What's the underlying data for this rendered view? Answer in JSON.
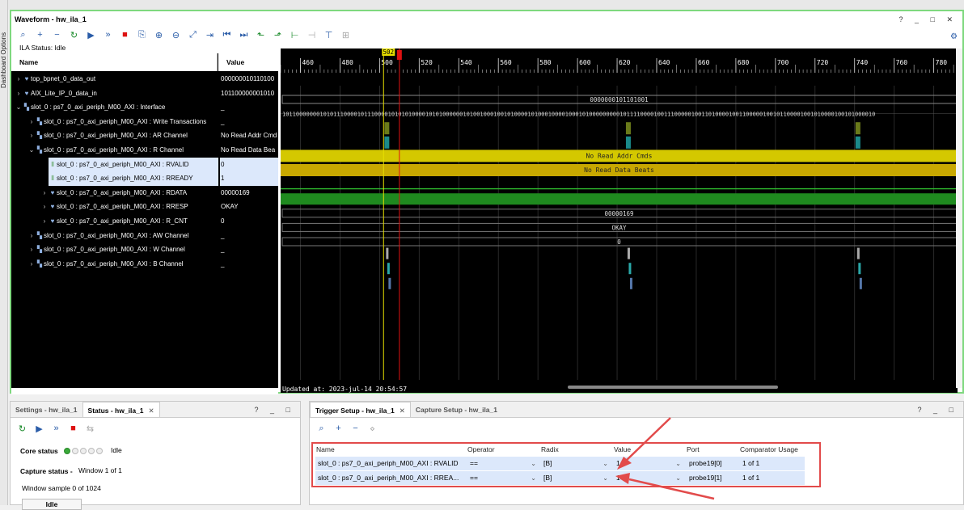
{
  "side_tab": {
    "label": "Dashboard Options"
  },
  "waveform": {
    "title": "Waveform - hw_ila_1",
    "window_buttons": "? _ □ ✕",
    "ila_status": "ILA Status: Idle",
    "col_name": "Name",
    "col_value": "Value",
    "signals": [
      {
        "name": "top_bpnet_0_data_out",
        "value": "000000010110100",
        "indent": 0,
        "arrow": "›",
        "icon": "bus"
      },
      {
        "name": "AIX_Lite_IP_0_data_in",
        "value": "101100000001010",
        "indent": 0,
        "arrow": "›",
        "icon": "bus"
      },
      {
        "name": "slot_0 : ps7_0_axi_periph_M00_AXI : Interface",
        "value": "_",
        "indent": 0,
        "arrow": "⌄",
        "icon": "iface"
      },
      {
        "name": "slot_0 : ps7_0_axi_periph_M00_AXI : Write Transactions",
        "value": "_",
        "indent": 1,
        "arrow": "›",
        "icon": "iface"
      },
      {
        "name": "slot_0 : ps7_0_axi_periph_M00_AXI : AR Channel",
        "value": "No Read Addr Cmd",
        "indent": 1,
        "arrow": "›",
        "icon": "iface"
      },
      {
        "name": "slot_0 : ps7_0_axi_periph_M00_AXI : R Channel",
        "value": "No Read Data Bea",
        "indent": 1,
        "arrow": "⌄",
        "icon": "iface"
      },
      {
        "name": "slot_0 : ps7_0_axi_periph_M00_AXI : RVALID",
        "value": "0",
        "indent": 2,
        "arrow": "",
        "icon": "bit",
        "selected": true
      },
      {
        "name": "slot_0 : ps7_0_axi_periph_M00_AXI : RREADY",
        "value": "1",
        "indent": 2,
        "arrow": "",
        "icon": "bit",
        "selected": true
      },
      {
        "name": "slot_0 : ps7_0_axi_periph_M00_AXI : RDATA",
        "value": "00000169",
        "indent": 2,
        "arrow": "›",
        "icon": "bus"
      },
      {
        "name": "slot_0 : ps7_0_axi_periph_M00_AXI : RRESP",
        "value": "OKAY",
        "indent": 2,
        "arrow": "›",
        "icon": "bus"
      },
      {
        "name": "slot_0 : ps7_0_axi_periph_M00_AXI : R_CNT",
        "value": "0",
        "indent": 2,
        "arrow": "›",
        "icon": "bus"
      },
      {
        "name": "slot_0 : ps7_0_axi_periph_M00_AXI : AW Channel",
        "value": "_",
        "indent": 1,
        "arrow": "›",
        "icon": "iface"
      },
      {
        "name": "slot_0 : ps7_0_axi_periph_M00_AXI : W Channel",
        "value": "_",
        "indent": 1,
        "arrow": "›",
        "icon": "iface"
      },
      {
        "name": "slot_0 : ps7_0_axi_periph_M00_AXI : B Channel",
        "value": "_",
        "indent": 1,
        "arrow": "›",
        "icon": "iface"
      }
    ],
    "timeline": {
      "ticks": [
        460,
        480,
        500,
        520,
        540,
        560,
        580,
        600,
        620,
        640,
        660,
        680,
        700,
        720,
        740,
        760,
        780
      ],
      "start": 450,
      "end": 792,
      "marker_value": "502",
      "marker_t": 502,
      "cursor_t": 510
    },
    "wave_labels": {
      "top_bpnet_value": "0000000101101001",
      "aix_bits": "101100000001010111000010111000010101010000101010000001010010001001010000101000100001000101000000000101111000010011100000100110100001001100000100101100001001010000100101000010",
      "ar_text": "No Read Addr Cmds",
      "r_text": "No Read Data Beats",
      "rdata_text": "00000169",
      "rresp_text": "OKAY",
      "rcnt_text": "0"
    },
    "updated_text": "Updated at: 2023-jul-14 20:54:57"
  },
  "settings_panel": {
    "tab_settings": "Settings - hw_ila_1",
    "tab_status": "Status - hw_ila_1",
    "close": "✕",
    "buttons": "? _ □",
    "core_status_label": "Core status",
    "core_status_value": "Idle",
    "capture_status_label": "Capture status -",
    "capture_status_value": "Window 1 of 1",
    "window_sample": "Window sample 0 of 1024",
    "idle_button": "Idle"
  },
  "trigger_panel": {
    "tab_trigger": "Trigger Setup - hw_ila_1",
    "tab_capture": "Capture Setup - hw_ila_1",
    "close": "✕",
    "buttons": "? _ □",
    "columns": [
      "Name",
      "Operator",
      "Radix",
      "Value",
      "Port",
      "Comparator Usage"
    ],
    "rows": [
      {
        "name": "slot_0 : ps7_0_axi_periph_M00_AXI : RVALID",
        "operator": "==",
        "radix": "[B]",
        "value": "1",
        "port": "probe19[0]",
        "usage": "1 of 1"
      },
      {
        "name": "slot_0 : ps7_0_axi_periph_M00_AXI : RREA...",
        "operator": "==",
        "radix": "[B]",
        "value": "1",
        "port": "probe19[1]",
        "usage": "1 of 1"
      }
    ]
  },
  "colors": {
    "wave_green": "#1f8a1f",
    "wave_yellow": "#d4c800",
    "cursor_red": "#d11",
    "marker_yellow": "#e8e000",
    "annotation_red": "#e24b4b"
  }
}
